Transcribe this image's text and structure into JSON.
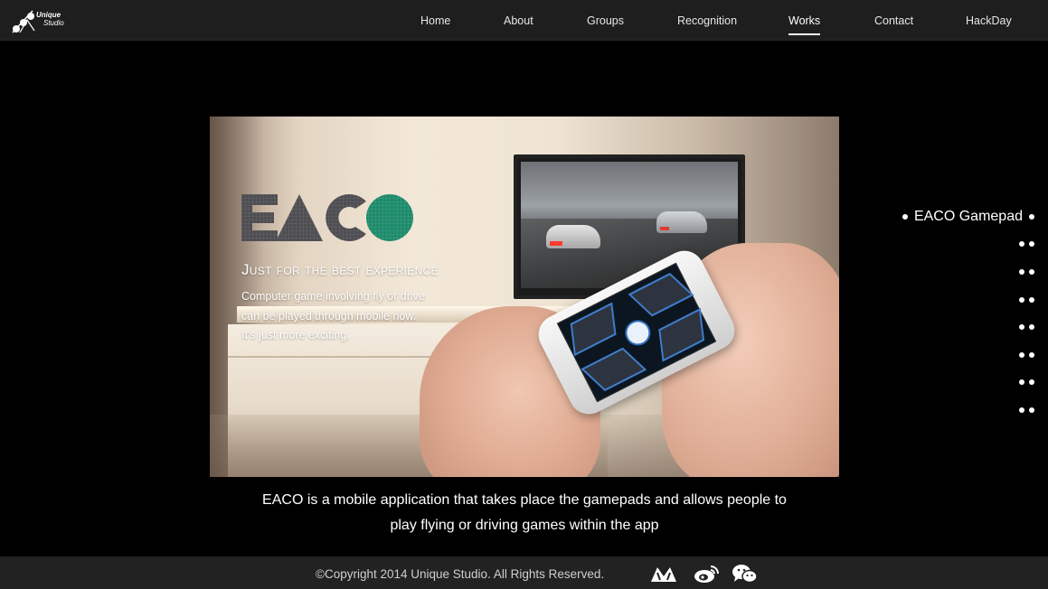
{
  "header": {
    "logo_line1": "Unique",
    "logo_line2": "Studio",
    "nav": [
      {
        "label": "Home"
      },
      {
        "label": "About"
      },
      {
        "label": "Groups"
      },
      {
        "label": "Recognition"
      },
      {
        "label": "Works",
        "active": true
      },
      {
        "label": "Contact"
      },
      {
        "label": "HackDay"
      }
    ]
  },
  "hero": {
    "brand": "EACO",
    "tagline": "Just for the best experience",
    "desc_lines": [
      "Computer game involving fly or drive",
      "can be played through mobile now.",
      "It's just more exciting."
    ]
  },
  "caption": {
    "line1": "EACO is a mobile application that takes place the gamepads and allows people to",
    "line2": "play flying or driving games within the app"
  },
  "slides": {
    "active_label": "EACO Gamepad",
    "count": 8,
    "active_index": 0
  },
  "footer": {
    "copyright": "©Copyright 2014 Unique Studio. All Rights Reserved.",
    "icons": [
      "unique-logo-icon",
      "weibo-icon",
      "wechat-icon"
    ]
  },
  "colors": {
    "background": "#000000",
    "navbar": "#1e1e1e",
    "footer": "#222222",
    "eaco_green": "#1f8a6a"
  }
}
